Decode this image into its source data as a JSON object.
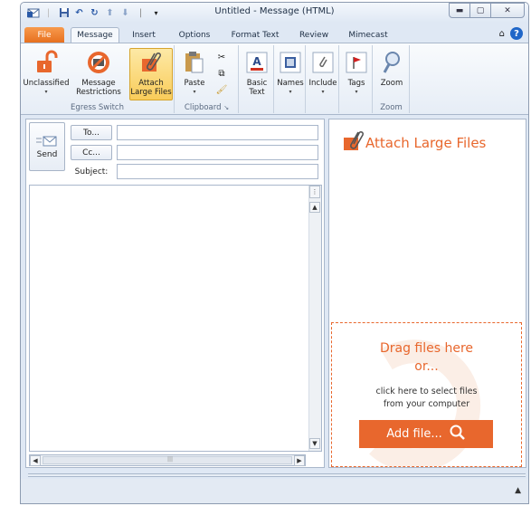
{
  "window": {
    "title": "Untitled  -  Message (HTML)"
  },
  "quick_access": [
    "outlook-icon",
    "save-icon",
    "undo-icon",
    "redo-icon",
    "up-arrow-icon",
    "down-arrow-icon",
    "customize-icon"
  ],
  "tabs": [
    {
      "label": "File"
    },
    {
      "label": "Message"
    },
    {
      "label": "Insert"
    },
    {
      "label": "Options"
    },
    {
      "label": "Format Text"
    },
    {
      "label": "Review"
    },
    {
      "label": "Mimecast"
    }
  ],
  "ribbon": {
    "egress": {
      "label": "Egress Switch",
      "unclassified": "Unclassified",
      "message_restrictions": "Message Restrictions",
      "attach_large_files": "Attach Large Files"
    },
    "clipboard": {
      "label": "Clipboard",
      "paste": "Paste"
    },
    "basic_text": "Basic Text",
    "names": "Names",
    "include": "Include",
    "tags": "Tags",
    "zoom": {
      "button": "Zoom",
      "label": "Zoom"
    }
  },
  "compose": {
    "send": "Send",
    "to": "To...",
    "cc": "Cc...",
    "subject": "Subject:",
    "to_value": "",
    "cc_value": "",
    "subject_value": ""
  },
  "panel": {
    "title": "Attach Large Files",
    "drag": "Drag files here",
    "or": "or...",
    "click_line1": "click here to select files",
    "click_line2": "from your computer",
    "add_file": "Add file..."
  },
  "colors": {
    "accent": "#e8672d",
    "file_tab": "#e7701f",
    "help": "#1f66c8"
  }
}
